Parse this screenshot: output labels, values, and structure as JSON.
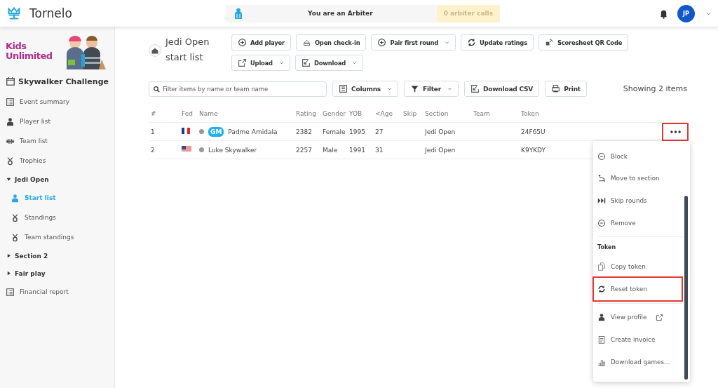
{
  "app": {
    "name": "Tornelo",
    "role_banner": "You are an Arbiter",
    "arbiter_calls": "0 arbiter calls",
    "avatar": "JP"
  },
  "sidebar": {
    "logo_text": [
      "Kids",
      "Unlimited"
    ],
    "event": "Skywalker Challenge",
    "items": [
      {
        "label": "Event summary",
        "selected": false
      },
      {
        "label": "Player list",
        "selected": false
      },
      {
        "label": "Team list",
        "selected": false
      },
      {
        "label": "Trophies",
        "selected": false
      },
      {
        "label": "Jedi Open",
        "expanded": true,
        "children": [
          {
            "label": "Start list",
            "selected": true
          },
          {
            "label": "Standings",
            "selected": false
          },
          {
            "label": "Team standings",
            "selected": false
          }
        ]
      },
      {
        "label": "Section 2",
        "expanded": false
      },
      {
        "label": "Fair play",
        "expanded": false
      },
      {
        "label": "Financial report",
        "selected": false
      }
    ]
  },
  "page": {
    "title": "Jedi Open start list",
    "actions": [
      {
        "label": "Add player",
        "dropdown": false
      },
      {
        "label": "Open check-in",
        "dropdown": false
      },
      {
        "label": "Pair first round",
        "dropdown": true
      },
      {
        "label": "Update ratings",
        "dropdown": false
      },
      {
        "label": "Scoresheet QR Code",
        "dropdown": false
      },
      {
        "label": "Upload",
        "dropdown": true
      },
      {
        "label": "Download",
        "dropdown": true
      }
    ]
  },
  "toolbar": {
    "search": {
      "placeholder": "Filter items by name or team name"
    },
    "buttons": [
      {
        "label": "Columns",
        "dropdown": true
      },
      {
        "label": "Filter",
        "dropdown": true
      },
      {
        "label": "Download CSV",
        "dropdown": false
      },
      {
        "label": "Print",
        "dropdown": false
      }
    ],
    "count": "Showing 2 items"
  },
  "table": {
    "columns": [
      "#",
      "Fed",
      "Name",
      "Rating",
      "Gender",
      "YOB",
      "<Age",
      "Skip",
      "Section",
      "Team",
      "Token"
    ],
    "rows": [
      {
        "cells": [
          "1",
          "",
          "Padme Amidala",
          "2382",
          "Female",
          "1995",
          "27",
          "",
          "Jedi Open",
          "",
          "24F65U"
        ],
        "title_badge": "GM",
        "menu_highlighted": true
      },
      {
        "cells": [
          "2",
          "",
          "Luke Skywalker",
          "2257",
          "Male",
          "1991",
          "31",
          "",
          "Jedi Open",
          "",
          "K9YKDY"
        ]
      }
    ]
  },
  "row_menu": {
    "groups": [
      {
        "items": [
          {
            "label": "Block",
            "highlighted": false
          },
          {
            "label": "Move to section",
            "highlighted": false
          },
          {
            "label": "Skip rounds",
            "highlighted": false
          },
          {
            "label": "Remove",
            "highlighted": false
          }
        ]
      },
      {
        "heading": "Token",
        "items": [
          {
            "label": "Copy token",
            "highlighted": false
          },
          {
            "label": "Reset token",
            "highlighted": true
          }
        ]
      },
      {
        "items": [
          {
            "label": "View profile",
            "external": true,
            "highlighted": false
          },
          {
            "label": "Create invoice",
            "highlighted": false
          },
          {
            "label": "Download games...",
            "highlighted": false
          }
        ]
      }
    ]
  }
}
